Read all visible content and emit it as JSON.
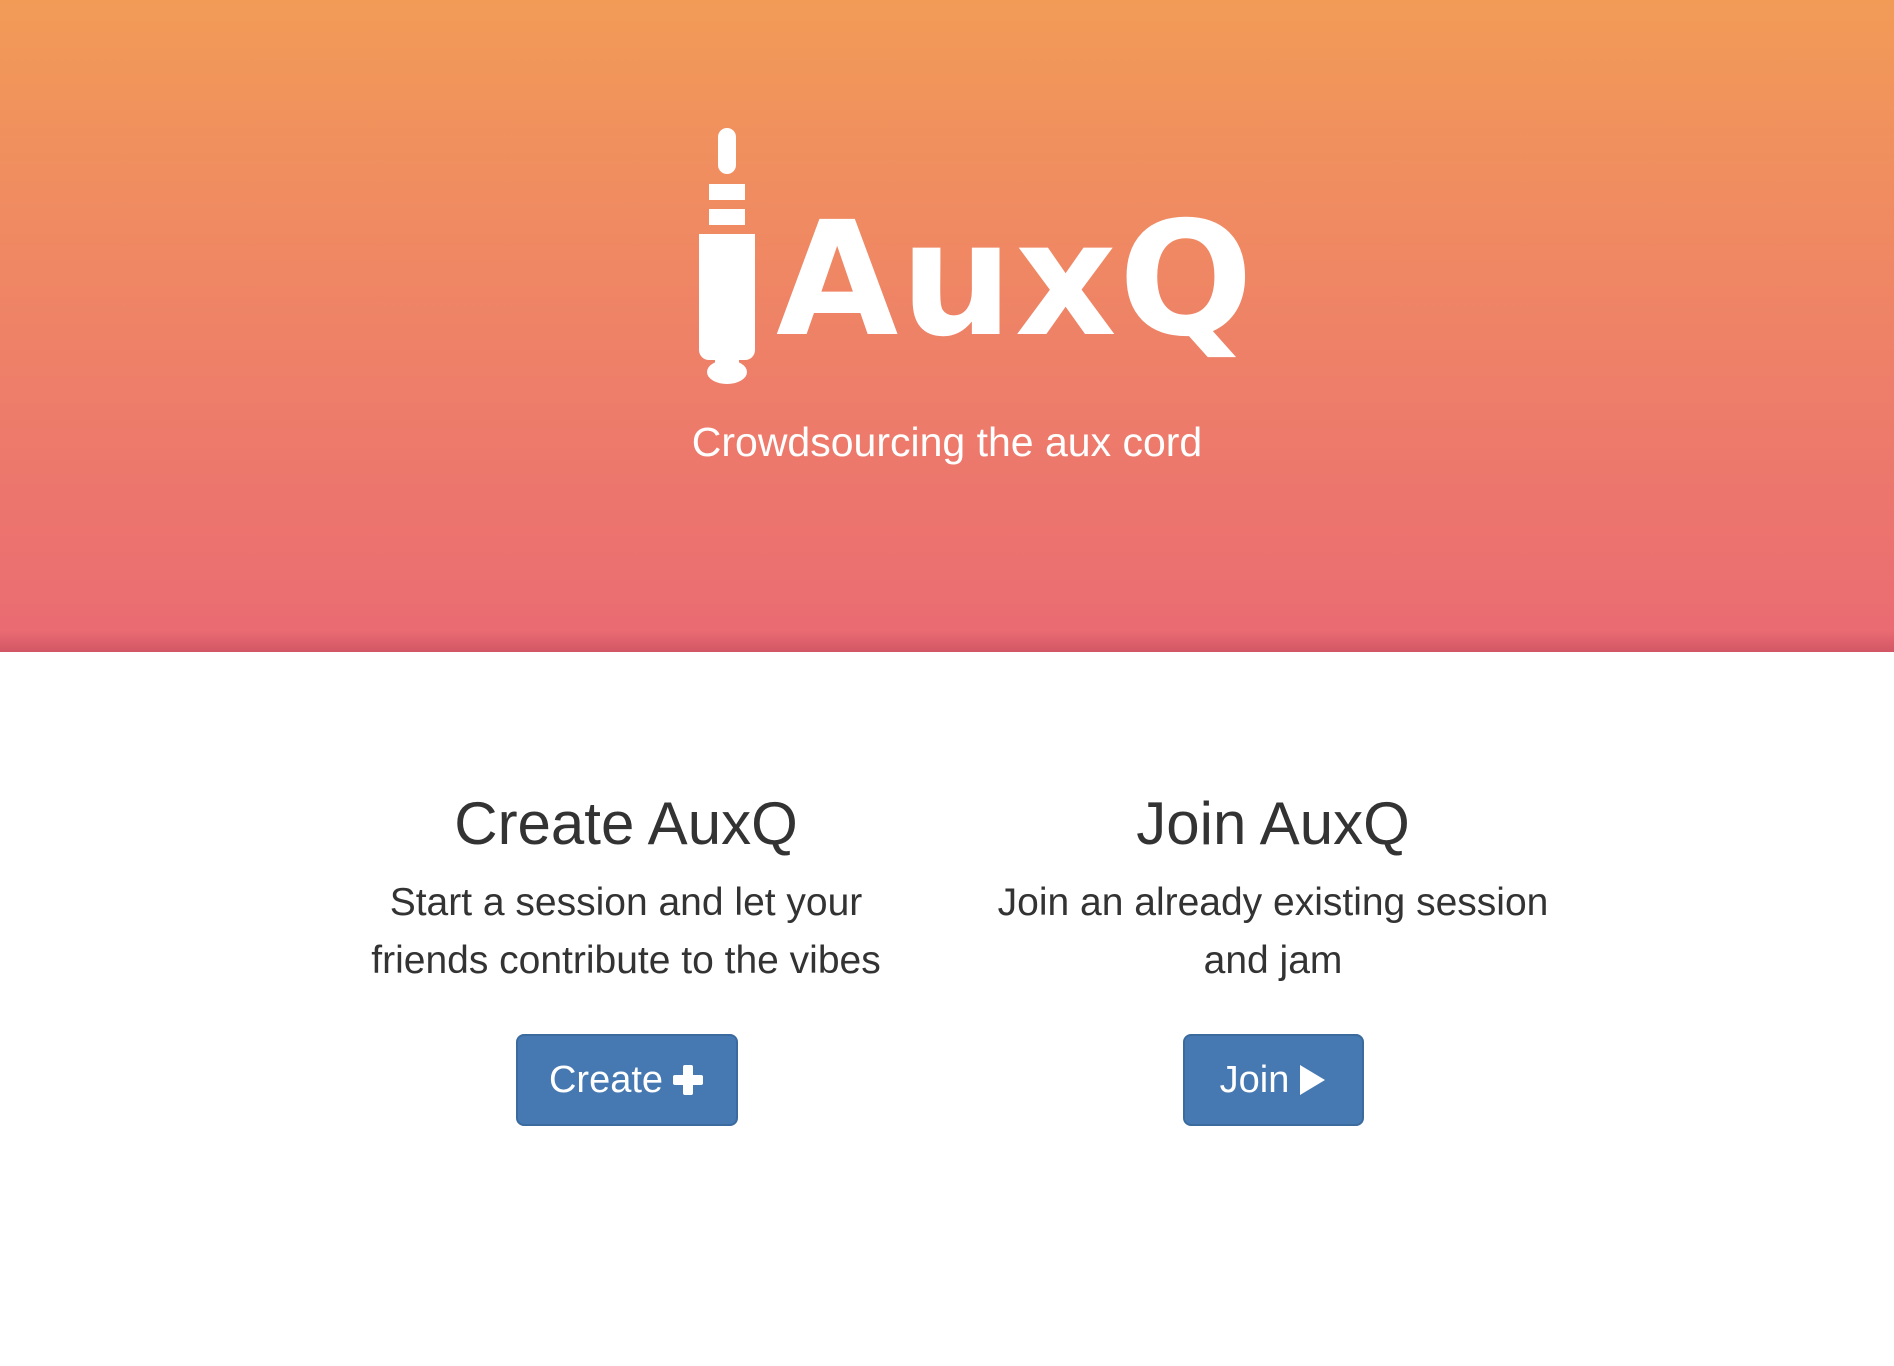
{
  "hero": {
    "logo_text": "AuxQ",
    "tagline": "Crowdsourcing the aux cord"
  },
  "create": {
    "title": "Create AuxQ",
    "description": "Start a session and let your friends contribute to the vibes",
    "button_label": "Create",
    "button_icon": "plus-icon"
  },
  "join": {
    "title": "Join AuxQ",
    "description": "Join an already existing session and jam",
    "button_label": "Join",
    "button_icon": "play-icon"
  },
  "colors": {
    "hero_top": "#f29b57",
    "hero_bottom": "#ea6a73",
    "button": "#4679b2",
    "text": "#333333"
  }
}
